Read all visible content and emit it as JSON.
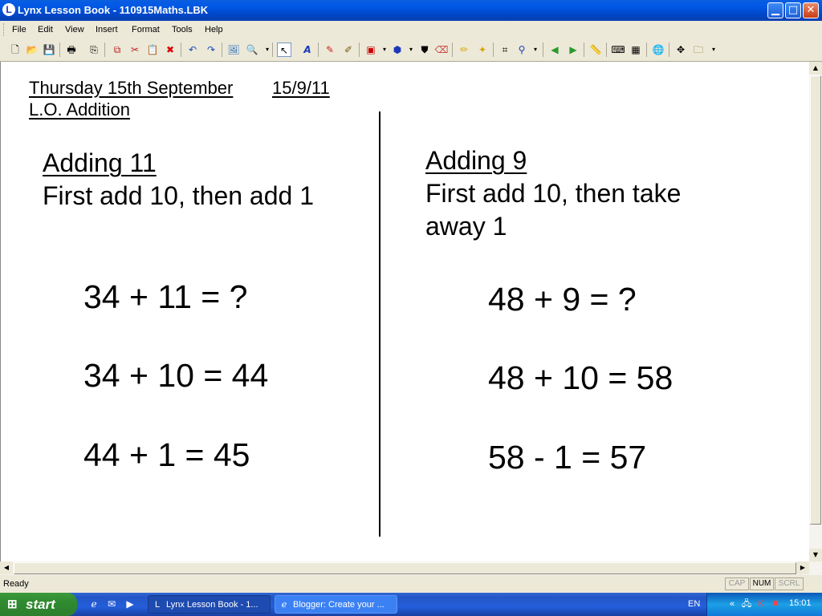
{
  "window": {
    "title": "Lynx Lesson Book - 110915Maths.LBK",
    "app_icon": "lynx-logo-icon",
    "controls": [
      "minimize-icon",
      "maximize-icon",
      "close-icon"
    ]
  },
  "menu": [
    "File",
    "Edit",
    "View",
    "Insert",
    "Format",
    "Tools",
    "Help"
  ],
  "toolbar": {
    "buttons": [
      "new-icon",
      "open-icon",
      "save-icon",
      "print-icon",
      "import-icon",
      "copy-icon",
      "cut-icon",
      "paste-icon",
      "delete-icon",
      "undo-icon",
      "redo-icon",
      "picture-icon",
      "zoom-icon",
      "select-icon",
      "text-icon",
      "pen-icon",
      "highlighter-icon",
      "shape-icon",
      "fill-icon",
      "bucket-icon",
      "eraser-icon",
      "marker-icon",
      "spotlight-icon",
      "crop-icon",
      "paint-icon",
      "back-icon",
      "forward-icon",
      "ruler-icon",
      "keyboard-icon",
      "calculator-icon",
      "globe-icon",
      "move-icon",
      "tools-icon"
    ]
  },
  "page": {
    "date": "Thursday 15th September",
    "short_date": "15/9/11",
    "objective": "L.O. Addition",
    "left": {
      "heading": "Adding 11",
      "instruction": "First add 10, then add 1",
      "equations": [
        "34 + 11 = ?",
        "34 + 10 = 44",
        "44 + 1 = 45"
      ]
    },
    "right": {
      "heading": "Adding 9",
      "instruction_line1": "First add 10, then take",
      "instruction_line2": "away 1",
      "equations": [
        "48 + 9 = ?",
        "48 + 10 = 58",
        "58 - 1 = 57"
      ]
    }
  },
  "status": {
    "text": "Ready",
    "indicators": [
      "CAP",
      "NUM",
      "SCRL"
    ]
  },
  "taskbar": {
    "start_label": "start",
    "tasks": [
      "Lynx Lesson Book - 1...",
      "Blogger: Create your ..."
    ],
    "language": "EN",
    "clock": "15:01"
  }
}
